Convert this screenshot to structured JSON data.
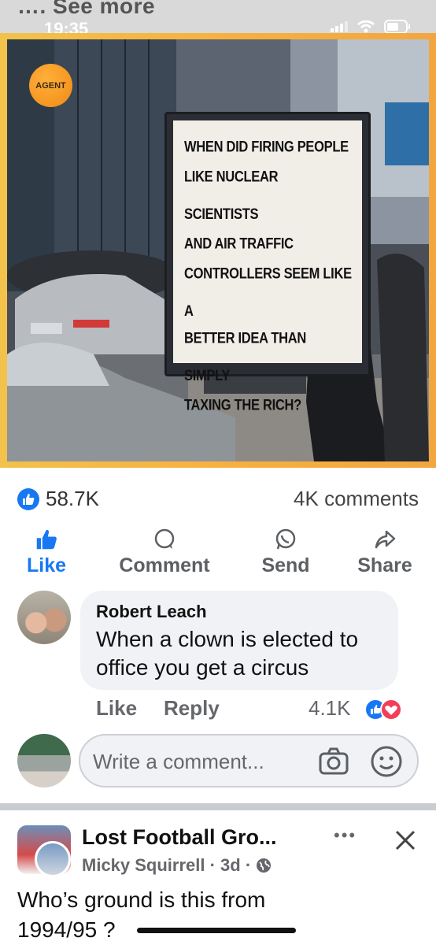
{
  "status_bar": {
    "see_more": "…. See more",
    "time": "19:35"
  },
  "photo": {
    "badge": "AGENT",
    "poster_lines": [
      "WHEN DID FIRING PEOPLE",
      "LIKE NUCLEAR SCIENTISTS",
      "AND AIR TRAFFIC",
      "CONTROLLERS SEEM LIKE A",
      "BETTER IDEA THAN SIMPLY",
      "TAXING THE RICH?"
    ]
  },
  "counts": {
    "likes": "58.7K",
    "comments": "4K comments"
  },
  "actions": {
    "like": "Like",
    "comment": "Comment",
    "send": "Send",
    "share": "Share"
  },
  "comment": {
    "author": "Robert Leach",
    "text": "When a clown is elected to office you get a circus",
    "like": "Like",
    "reply": "Reply",
    "reaction_count": "4.1K"
  },
  "write_comment": {
    "placeholder": "Write a comment..."
  },
  "next_post": {
    "group_name": "Lost Football Gro...",
    "poster": "Micky Squirrell · 3d ·",
    "text": "Who’s ground is this from 1994/95 ?"
  },
  "colors": {
    "accent": "#1877f2",
    "love": "#f33e58",
    "bubble": "#f0f2f5"
  },
  "icons": [
    "thumbs-up-icon",
    "comment-icon",
    "whatsapp-icon",
    "share-icon",
    "camera-icon",
    "smiley-icon",
    "globe-icon",
    "close-icon",
    "more-icon"
  ]
}
